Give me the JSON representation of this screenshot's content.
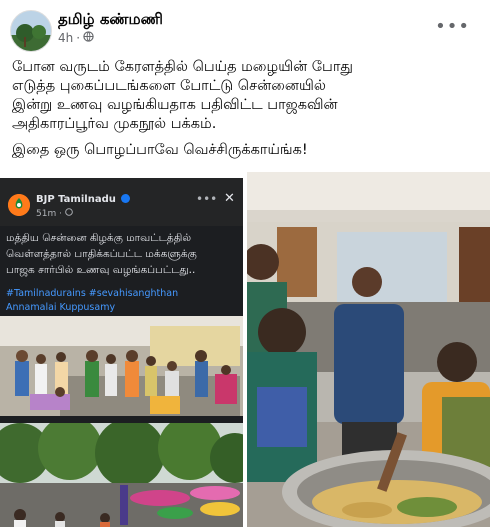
{
  "post": {
    "author": "தமிழ் கண்மணி",
    "time": "4h",
    "visibility_icon": "globe-icon",
    "more_icon": "ellipsis-icon",
    "text_1": "போன வருடம் கேரளத்தில் பெய்த மழையின் போது\nஎடுத்த புகைப்படங்களை போட்டு சென்னையில்\nஇன்று உணவு வழங்கியதாக பதிவிட்ட பாஜகவின்\nஅதிகாரப்பூர்வ முகநூல் பக்கம்.",
    "text_2": "இதை ஒரு பொழப்பாவே வெச்சிருக்காய்ங்க!"
  },
  "embedded": {
    "page_name": "BJP Tamilnadu",
    "time": "51m",
    "text": "மத்திய சென்னை கிழக்கு மாவட்டத்தில்\nவெள்ளத்தால் பாதிக்கப்பட்ட மக்களுக்கு\nபாஜக சார்பில் உணவு வழங்கப்பட்டது..",
    "tags": "#Tamilnadurains #sevahisanghthan\nAnnamalai Kuppusamy",
    "close_icon": "close-icon"
  },
  "colors": {
    "link": "#4599ff",
    "meta": "#65676b",
    "dark_card": "#1c1e21"
  }
}
